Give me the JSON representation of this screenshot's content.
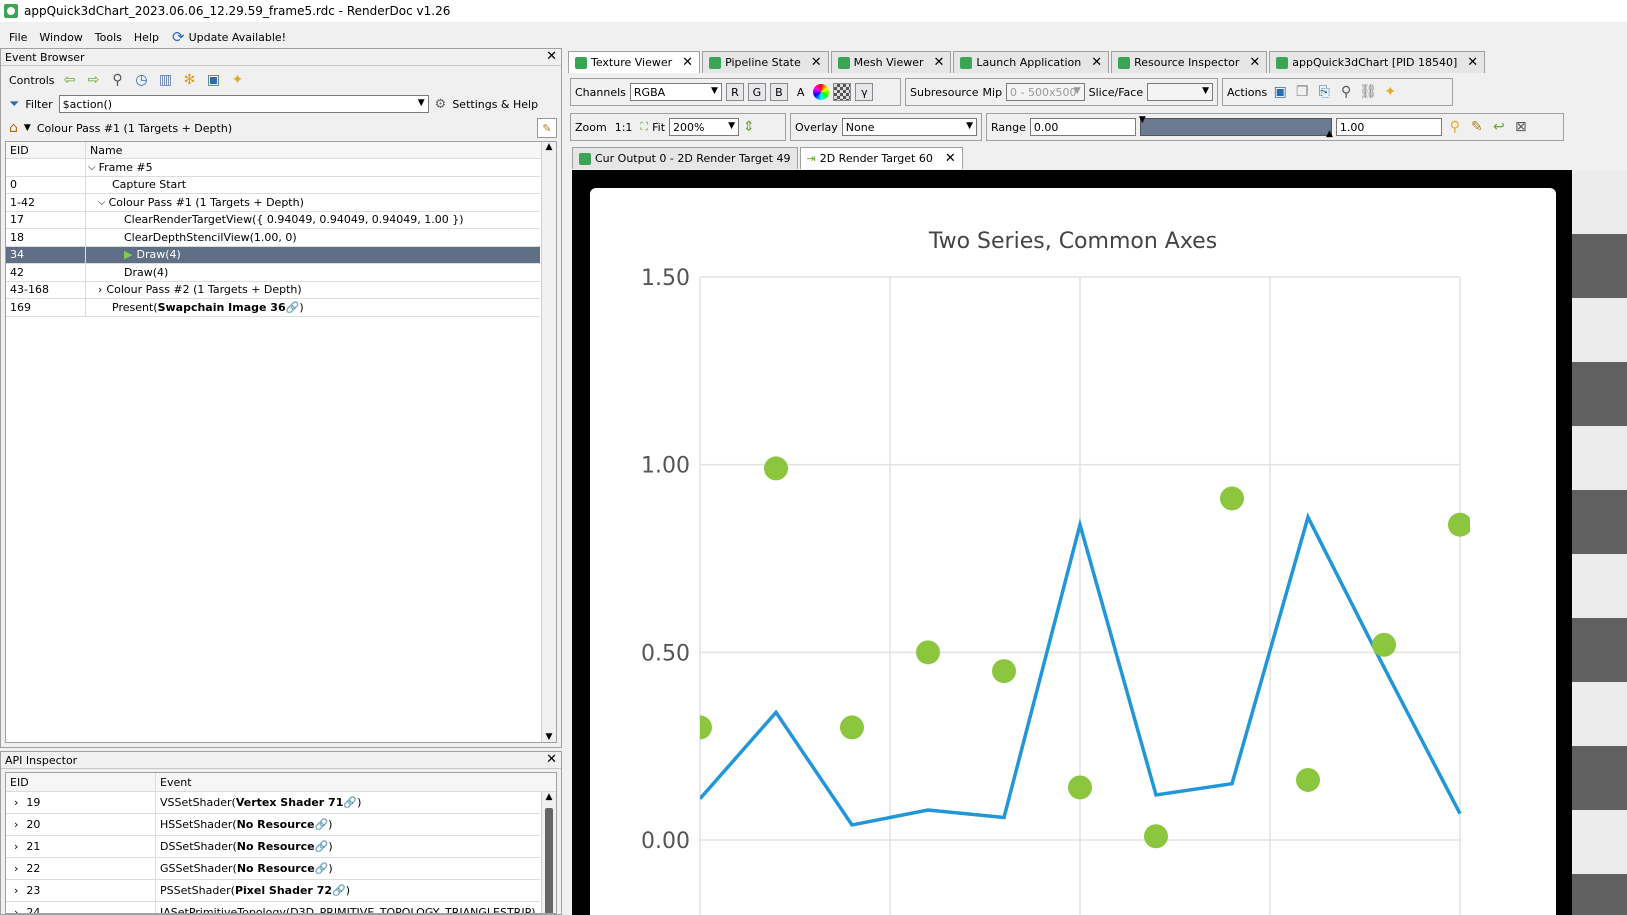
{
  "window": {
    "title": "appQuick3dChart_2023.06.06_12.29.59_frame5.rdc - RenderDoc v1.26"
  },
  "menu": {
    "file": "File",
    "window": "Window",
    "tools": "Tools",
    "help": "Help",
    "update": "Update Available!"
  },
  "event_browser": {
    "title": "Event Browser",
    "controls_label": "Controls",
    "filter_label": "Filter",
    "filter_value": "$action()",
    "settings_label": "Settings & Help",
    "breadcrumb": "Colour Pass #1 (1 Targets + Depth)",
    "col_eid": "EID",
    "col_name": "Name",
    "rows": [
      {
        "eid": "",
        "name": "Frame #5"
      },
      {
        "eid": "0",
        "name": "Capture Start"
      },
      {
        "eid": "1-42",
        "name": "Colour Pass #1 (1 Targets + Depth)"
      },
      {
        "eid": "17",
        "name": "ClearRenderTargetView({ 0.94049, 0.94049, 0.94049, 1.00 })"
      },
      {
        "eid": "18",
        "name": "ClearDepthStencilView(1.00, 0)"
      },
      {
        "eid": "34",
        "name": "Draw(4)"
      },
      {
        "eid": "42",
        "name": "Draw(4)"
      },
      {
        "eid": "43-168",
        "name": "Colour Pass #2 (1 Targets + Depth)"
      },
      {
        "eid": "169",
        "name": "Present(",
        "bold": "Swapchain Image 36",
        "tail": ")"
      }
    ]
  },
  "api_inspector": {
    "title": "API Inspector",
    "col_eid": "EID",
    "col_event": "Event",
    "rows": [
      {
        "eid": "19",
        "fn": "VSSetShader(",
        "arg": "Vertex Shader 71",
        "tail": ")"
      },
      {
        "eid": "20",
        "fn": "HSSetShader(",
        "arg": "No Resource",
        "tail": ")"
      },
      {
        "eid": "21",
        "fn": "DSSetShader(",
        "arg": "No Resource",
        "tail": ")"
      },
      {
        "eid": "22",
        "fn": "GSSetShader(",
        "arg": "No Resource",
        "tail": ")"
      },
      {
        "eid": "23",
        "fn": "PSSetShader(",
        "arg": "Pixel Shader 72",
        "tail": ")"
      },
      {
        "eid": "24",
        "fn": "IASetPrimitiveTopology(D3D_PRIMITIVE_TOPOLOGY_TRIANGLESTRIP)",
        "arg": "",
        "tail": ""
      }
    ]
  },
  "tabs": [
    "Texture Viewer",
    "Pipeline State",
    "Mesh Viewer",
    "Launch Application",
    "Resource Inspector",
    "appQuick3dChart [PID 18540]"
  ],
  "texture_toolbar": {
    "channels_label": "Channels",
    "channels_value": "RGBA",
    "r": "R",
    "g": "G",
    "b": "B",
    "a": "A",
    "gamma": "γ",
    "subresource_label": "Subresource",
    "mip_label": "Mip",
    "mip_value": "0 - 500x500",
    "slice_label": "Slice/Face",
    "actions_label": "Actions",
    "zoom_label": "Zoom",
    "zoom_11": "1:1",
    "fit_label": "Fit",
    "zoom_value": "200%",
    "overlay_label": "Overlay",
    "overlay_value": "None",
    "range_label": "Range",
    "range_min": "0.00",
    "range_max": "1.00"
  },
  "target_tabs": [
    "Cur Output 0 - 2D Render Target 49",
    "2D Render Target 60"
  ],
  "chart_data": {
    "type": "line",
    "title": "Two Series, Common Axes",
    "yticks": [
      "1.50",
      "1.00",
      "0.50",
      "0.00"
    ],
    "ylim": [
      0,
      1.5
    ],
    "xlim": [
      0.5,
      5.5
    ],
    "line_color": "#2196d8",
    "dot_color": "#8cc63f",
    "line": {
      "x": [
        0.5,
        1.0,
        1.5,
        2.0,
        2.5,
        3.0,
        3.5,
        4.0,
        4.5,
        5.0,
        5.5
      ],
      "y": [
        0.11,
        0.34,
        0.04,
        0.08,
        0.06,
        0.84,
        0.12,
        0.15,
        0.86,
        0.46,
        0.07
      ]
    },
    "scatter": {
      "x": [
        0.5,
        1.0,
        1.5,
        2.0,
        2.5,
        3.0,
        3.5,
        4.0,
        4.5,
        5.0,
        5.5
      ],
      "y": [
        0.3,
        0.99,
        0.3,
        0.5,
        0.45,
        0.14,
        0.01,
        0.91,
        0.16,
        0.52,
        0.84
      ]
    }
  }
}
